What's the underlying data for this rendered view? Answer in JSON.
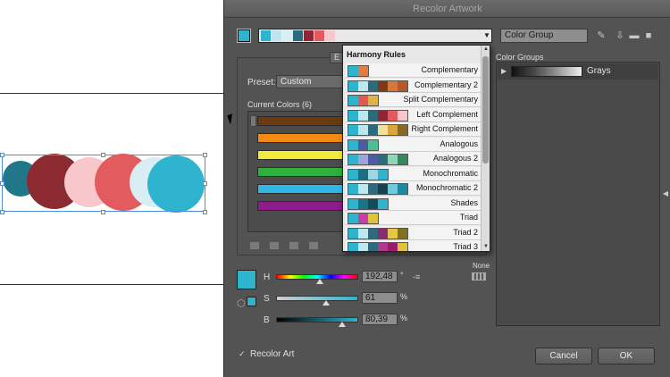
{
  "dialog": {
    "title": "Recolor Artwork"
  },
  "active_color": "#2fb4cf",
  "group_strip": [
    "#2fb4cf",
    "#bfe6ef",
    "#d9eef2",
    "#2c6c7d",
    "#8e2733",
    "#e25a5d",
    "#f7c8cb"
  ],
  "color_group_name": "Color Group",
  "edit_tab": "E",
  "preset": {
    "label": "Preset:",
    "value": "Custom"
  },
  "current_colors": {
    "label": "Current Colors (6)",
    "colors": [
      "#6b3a10",
      "#f28a14",
      "#f1ed3a",
      "#2fb03c",
      "#2fb8e6",
      "#8b1c8a"
    ]
  },
  "harmony": {
    "title": "Harmony Rules",
    "rules": [
      {
        "name": "Complementary",
        "swatches": [
          "#2fb4cf",
          "#e17c43"
        ]
      },
      {
        "name": "Complementary 2",
        "swatches": [
          "#2fb4cf",
          "#c0e6ee",
          "#2d6a7c",
          "#7c3a16",
          "#d8773b",
          "#b7582a"
        ]
      },
      {
        "name": "Split Complementary",
        "swatches": [
          "#2fb4cf",
          "#e35a55",
          "#e2b24a"
        ]
      },
      {
        "name": "Left Complement",
        "swatches": [
          "#2fb4cf",
          "#c0e6ee",
          "#2d6a7c",
          "#8e2733",
          "#e25a5d",
          "#f7c8cb"
        ]
      },
      {
        "name": "Right Complement",
        "swatches": [
          "#2fb4cf",
          "#c0e6ee",
          "#2d6a7c",
          "#f2e0a2",
          "#d9a83d",
          "#8a6a23"
        ]
      },
      {
        "name": "Analogous",
        "swatches": [
          "#2fb4cf",
          "#4d5aa8",
          "#4cc08f"
        ]
      },
      {
        "name": "Analogous 2",
        "swatches": [
          "#2fb4cf",
          "#9fa6d6",
          "#4d5aa8",
          "#2d6a7c",
          "#8fd6b8",
          "#2e8a5d"
        ]
      },
      {
        "name": "Monochromatic",
        "swatches": [
          "#2fb4cf",
          "#1c6e80",
          "#9ed7e4",
          "#2fb4cf"
        ]
      },
      {
        "name": "Monochromatic 2",
        "swatches": [
          "#2fb4cf",
          "#c0e6ee",
          "#2d6a7c",
          "#1c3f4a",
          "#6ec9dc",
          "#1a8aa4"
        ]
      },
      {
        "name": "Shades",
        "swatches": [
          "#2fb4cf",
          "#1d7386",
          "#134c59",
          "#2fb4cf"
        ]
      },
      {
        "name": "Triad",
        "swatches": [
          "#2fb4cf",
          "#c93da6",
          "#e0c23c"
        ]
      },
      {
        "name": "Triad 2",
        "swatches": [
          "#2fb4cf",
          "#c0e6ee",
          "#2d6a7c",
          "#8a2a70",
          "#e2c74a",
          "#807020"
        ]
      },
      {
        "name": "Triad 3",
        "swatches": [
          "#2fb4cf",
          "#c0e6ee",
          "#2d6a7c",
          "#b03a8c",
          "#9a1c6c",
          "#e0c23c"
        ]
      }
    ]
  },
  "color_groups": {
    "label": "Color Groups",
    "items": [
      {
        "name": "Grays"
      }
    ]
  },
  "sliders": {
    "h": {
      "label": "H",
      "value": "192,48",
      "unit": "°",
      "fraction": 0.535
    },
    "s": {
      "label": "S",
      "value": "61",
      "unit": "%",
      "fraction": 0.61
    },
    "b": {
      "label": "B",
      "value": "80,39",
      "unit": "%",
      "fraction": 0.8
    }
  },
  "none_label": "None",
  "recolor_art": {
    "label": "Recolor Art",
    "checked": true
  },
  "buttons": {
    "cancel": "Cancel",
    "ok": "OK"
  },
  "artboard_circles": [
    "#22768a",
    "#8b2a30",
    "#f7c7cb",
    "#e25b5e",
    "#d9eef3",
    "#2fb4cf"
  ]
}
